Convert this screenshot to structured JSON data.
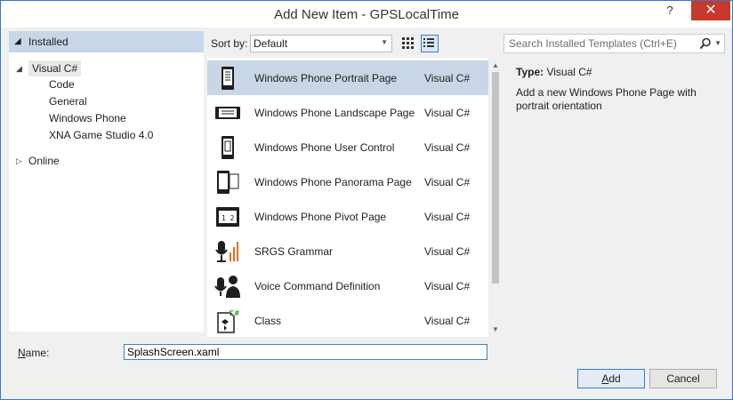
{
  "window": {
    "title": "Add New Item - GPSLocalTime",
    "help": "?",
    "close": "✕"
  },
  "tree": {
    "installed": "Installed",
    "visual_csharp": "Visual C#",
    "children": [
      "Code",
      "General",
      "Windows Phone",
      "XNA Game Studio 4.0"
    ],
    "online": "Online"
  },
  "toolbar": {
    "sort_label": "Sort by:",
    "sort_value": "Default",
    "search_placeholder": "Search Installed Templates (Ctrl+E)"
  },
  "templates": [
    {
      "name": "Windows Phone Portrait Page",
      "lang": "Visual C#",
      "icon": "phone-portrait-icon",
      "selected": true
    },
    {
      "name": "Windows Phone Landscape Page",
      "lang": "Visual C#",
      "icon": "phone-landscape-icon"
    },
    {
      "name": "Windows Phone User Control",
      "lang": "Visual C#",
      "icon": "user-control-icon"
    },
    {
      "name": "Windows Phone Panorama Page",
      "lang": "Visual C#",
      "icon": "panorama-page-icon"
    },
    {
      "name": "Windows Phone Pivot Page",
      "lang": "Visual C#",
      "icon": "pivot-page-icon"
    },
    {
      "name": "SRGS Grammar",
      "lang": "Visual C#",
      "icon": "srgs-grammar-icon"
    },
    {
      "name": "Voice Command Definition",
      "lang": "Visual C#",
      "icon": "voice-command-icon"
    },
    {
      "name": "Class",
      "lang": "Visual C#",
      "icon": "csharp-class-icon"
    }
  ],
  "details": {
    "type_label": "Type:",
    "type_value": "Visual C#",
    "description": "Add a new Windows Phone Page with portrait orientation"
  },
  "footer": {
    "name_label_first": "N",
    "name_label_rest": "ame:",
    "name_value": "SplashScreen.xaml",
    "add_first": "A",
    "add_rest": "dd",
    "cancel": "Cancel"
  },
  "colors": {
    "selection": "#c9d6e7",
    "close_button": "#c7392b",
    "accent": "#3b7ad0"
  }
}
